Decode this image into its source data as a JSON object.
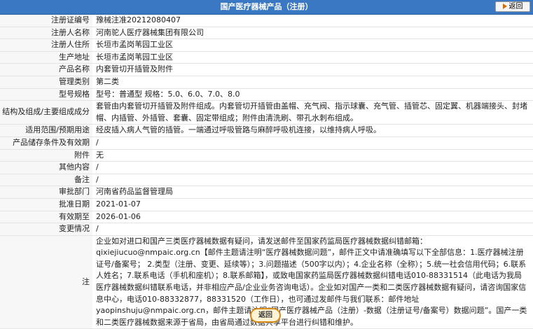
{
  "header": {
    "title": "国产医疗器械产品（注册）",
    "back_label": "返回"
  },
  "rows": [
    {
      "label": "注册证编号",
      "value": "豫械注准20212080407"
    },
    {
      "label": "注册人名称",
      "value": "河南驼人医疗器械集团有限公司"
    },
    {
      "label": "注册人住所",
      "value": "长垣市孟岗苇园工业区"
    },
    {
      "label": "生产地址",
      "value": "长垣市孟岗苇园工业区"
    },
    {
      "label": "产品名称",
      "value": "内套管切开插管及附件"
    },
    {
      "label": "管理类别",
      "value": "第二类"
    },
    {
      "label": "型号规格",
      "value": "型号：普通型 规格：5.0、6.0、7.0、8.0"
    },
    {
      "label": "结构及组成/主要组成成分",
      "value": "套管由内套管切开插管及附件组成。内套管切开插管由盖帽、充气阀、指示球囊、充气管、插管芯、固定翼、机器端接头、封堵帽、内插管、外插管、套囊、固定带组成；附件由清洗刷、带孔水刺布组成。"
    },
    {
      "label": "适用范围/预期用途",
      "value": "经皮插入病人气管的插管。一端通过呼吸管路与麻醉呼吸机连接，以维持病人呼吸。"
    },
    {
      "label": "产品储存条件及有效期",
      "value": "/"
    },
    {
      "label": "附件",
      "value": "无"
    },
    {
      "label": "其他内容",
      "value": "/"
    },
    {
      "label": "备注",
      "value": "/"
    },
    {
      "label": "审批部门",
      "value": "河南省药品监督管理局"
    },
    {
      "label": "批准日期",
      "value": "2021-01-07"
    },
    {
      "label": "有效期至",
      "value": "2026-01-06"
    },
    {
      "label": "变更情况",
      "value": "/"
    },
    {
      "label": "注",
      "value": "企业如对进口和国产三类医疗器械数据有疑问，请发送邮件至国家药监局医疗器械数据纠错邮箱：qixiejiucuo@nmpaic.org.cn【邮件主题请注明“医疗器械数据问题”，邮件正文中请准确填写以下全部信息：1.医疗器械注册证号/备案号； 2.类型（注册、变更、延续等）；3.问题描述（500字以内）；4.企业名称（全称）；5.统一社会信用代码；6.联系人姓名；7.联系电话（手机和座机）；8.联系邮箱】，或致电国家药监局医疗器械数据纠错电话010-88331514（此电话为我局医疗器械数据纠错联系电话，并非相应产品/企业业务咨询电话）。企业如对国产一类和二类医疗器械数据有疑问，请咨询国家信息中心，电话010-88332877，88331520（工作日），也可通过发邮件与我们联系：邮件地址yaopinshuju@nmpaic.org.cn，邮件主题请注明“国产医疗器械产品（注册）-数据（注册证号/备案号）数据问题”。国产一类和二类医疗器械数据来源于省局，由省局通过数据共享平台进行纠错和维护。"
    }
  ],
  "footer": {
    "back_label": "返回"
  },
  "colors": {
    "header_bg": "#3a78c4",
    "accent": "#d98a16"
  }
}
